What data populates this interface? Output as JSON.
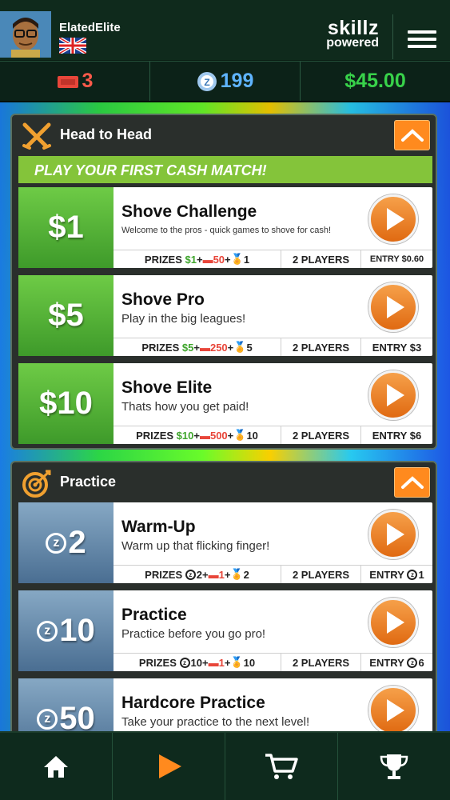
{
  "user": {
    "name": "ElatedElite",
    "flag": "uk-flag"
  },
  "brand": {
    "line1": "skillz",
    "line2": "powered"
  },
  "stats": {
    "tickets": "3",
    "z_coins": "199",
    "cash": "$45.00"
  },
  "head_to_head": {
    "title": "Head to Head",
    "promo": "PLAY YOUR FIRST CASH MATCH!",
    "cards": [
      {
        "amount": "$1",
        "title": "Shove Challenge",
        "desc": "Welcome to the pros - quick games to shove for cash!",
        "prize_cash": "$1",
        "prize_tickets": "50",
        "prize_medal": "1",
        "players": "2 PLAYERS",
        "entry": "ENTRY $0.60"
      },
      {
        "amount": "$5",
        "title": "Shove Pro",
        "desc": "Play in the big leagues!",
        "prize_cash": "$5",
        "prize_tickets": "250",
        "prize_medal": "5",
        "players": "2 PLAYERS",
        "entry": "ENTRY $3"
      },
      {
        "amount": "$10",
        "title": "Shove Elite",
        "desc": "Thats how you get paid!",
        "prize_cash": "$10",
        "prize_tickets": "500",
        "prize_medal": "10",
        "players": "2 PLAYERS",
        "entry": "ENTRY $6"
      }
    ]
  },
  "practice": {
    "title": "Practice",
    "cards": [
      {
        "amount": "2",
        "title": "Warm-Up",
        "desc": "Warm up that flicking finger!",
        "prize_z": "2",
        "prize_tickets": "1",
        "prize_medal": "2",
        "players": "2 PLAYERS",
        "entry_label": "ENTRY",
        "entry_z": "1"
      },
      {
        "amount": "10",
        "title": "Practice",
        "desc": "Practice before you go pro!",
        "prize_z": "10",
        "prize_tickets": "1",
        "prize_medal": "10",
        "players": "2 PLAYERS",
        "entry_label": "ENTRY",
        "entry_z": "6"
      },
      {
        "amount": "50",
        "title": "Hardcore Practice",
        "desc": "Take your practice to the next level!"
      }
    ]
  },
  "labels": {
    "prizes": "PRIZES",
    "plus": "+",
    "z": "z"
  },
  "nav": [
    "home-icon",
    "play-icon",
    "cart-icon",
    "trophy-icon"
  ],
  "colors": {
    "accent_orange": "#ff8a1e",
    "cash_green": "#38d24a",
    "ticket_red": "#ff5a4a",
    "z_blue": "#5fb4ff"
  }
}
